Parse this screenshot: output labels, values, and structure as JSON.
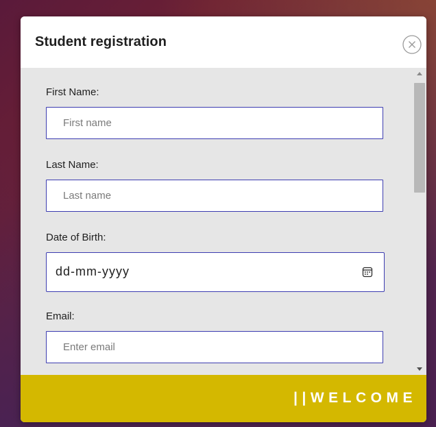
{
  "modal": {
    "title": "Student registration",
    "close_icon": "close-circle-icon"
  },
  "form": {
    "first_name": {
      "label": "First Name:",
      "placeholder": "First name"
    },
    "last_name": {
      "label": "Last Name:",
      "placeholder": "Last name"
    },
    "dob": {
      "label": "Date of Birth:",
      "value": "dd-mm-yyyy",
      "icon": "calendar-icon"
    },
    "email": {
      "label": "Email:",
      "placeholder": "Enter email"
    }
  },
  "footer": {
    "text": "||WELCOME"
  },
  "colors": {
    "footer_bg": "#d4b800",
    "input_border": "#3b3bb0",
    "body_bg": "#e6e6e6"
  }
}
